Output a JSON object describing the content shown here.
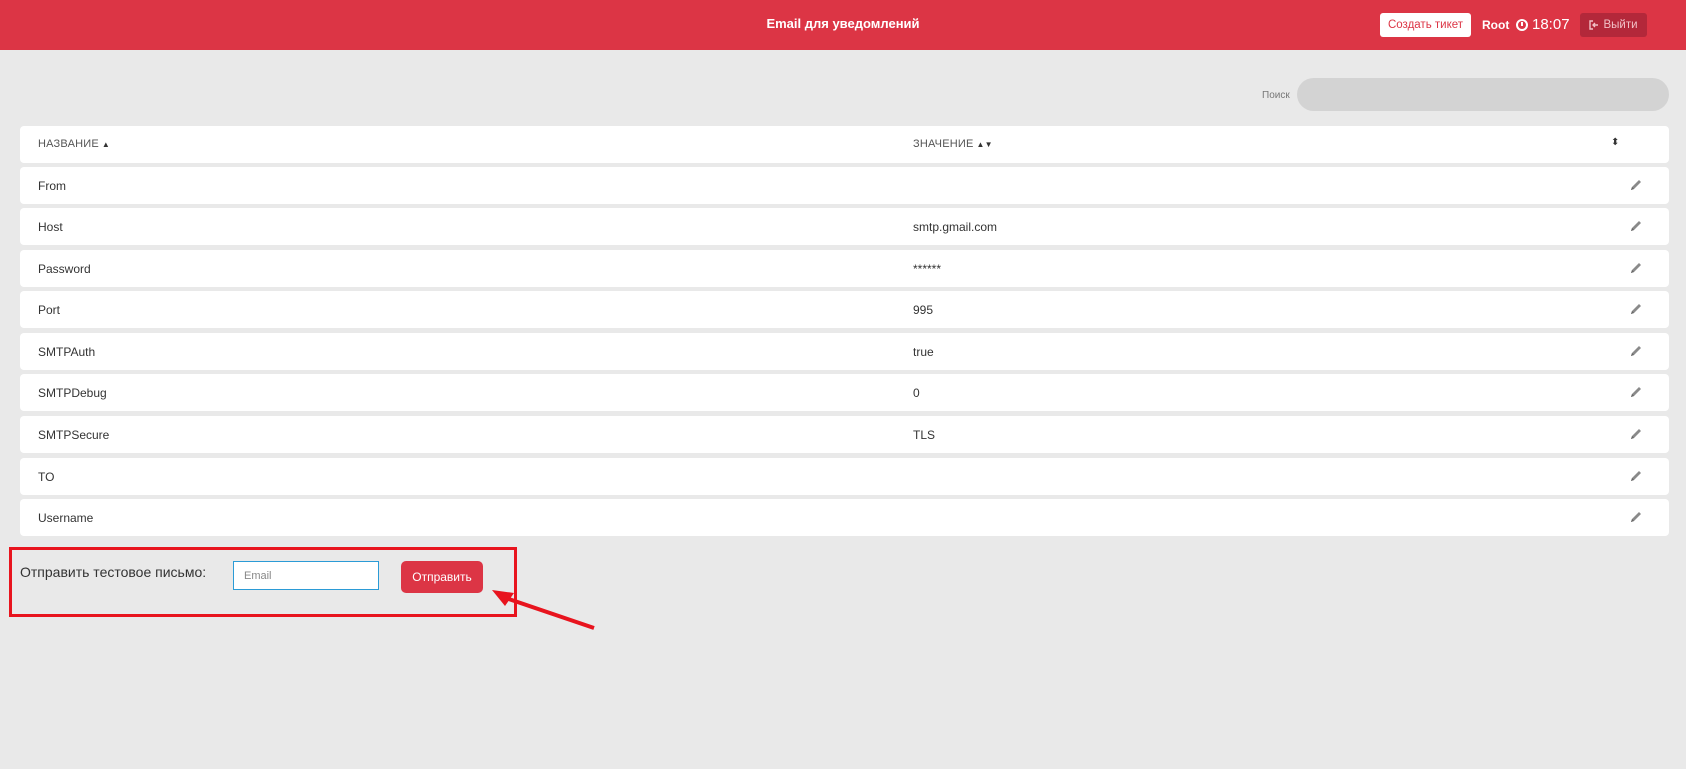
{
  "header": {
    "title": "Email для уведомлений",
    "create_ticket_label": "Создать тикет",
    "user": "Root",
    "time": "18:07",
    "logout_label": "Выйти"
  },
  "search": {
    "label": "Поиск",
    "value": ""
  },
  "table": {
    "columns": [
      "НАЗВАНИЕ",
      "ЗНАЧЕНИЕ"
    ],
    "rows": [
      {
        "name": "From",
        "value": ""
      },
      {
        "name": "Host",
        "value": "smtp.gmail.com"
      },
      {
        "name": "Password",
        "value": "******"
      },
      {
        "name": "Port",
        "value": "995"
      },
      {
        "name": "SMTPAuth",
        "value": "true"
      },
      {
        "name": "SMTPDebug",
        "value": "0"
      },
      {
        "name": "SMTPSecure",
        "value": "TLS"
      },
      {
        "name": "TO",
        "value": ""
      },
      {
        "name": "Username",
        "value": ""
      }
    ]
  },
  "test": {
    "label": "Отправить тестовое письмо:",
    "placeholder": "Email",
    "send_label": "Отправить"
  },
  "colors": {
    "brand": "#dc3545",
    "highlight": "#e8141e",
    "background": "#e9e9e9"
  }
}
